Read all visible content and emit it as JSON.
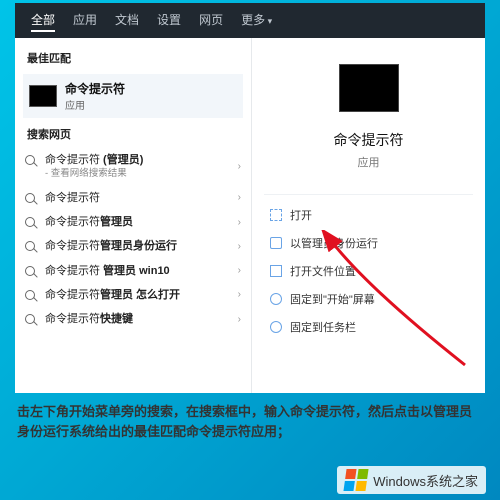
{
  "tabs": {
    "all": "全部",
    "apps": "应用",
    "docs": "文档",
    "settings": "设置",
    "web": "网页",
    "more": "更多"
  },
  "sections": {
    "best_match": "最佳匹配",
    "search_web": "搜索网页"
  },
  "best_match": {
    "title": "命令提示符",
    "subtitle": "应用"
  },
  "web_results": [
    {
      "base": "命令提示符",
      "suffix": " (管理员)",
      "note": "- 查看网络搜索结果"
    },
    {
      "base": "命令提示符",
      "suffix": "",
      "note": ""
    },
    {
      "base": "命令提示符",
      "suffix": "管理员",
      "note": ""
    },
    {
      "base": "命令提示符",
      "suffix": "管理员身份运行",
      "note": ""
    },
    {
      "base": "命令提示符",
      "suffix": " 管理员 win10",
      "note": ""
    },
    {
      "base": "命令提示符",
      "suffix": "管理员 怎么打开",
      "note": ""
    },
    {
      "base": "命令提示符",
      "suffix": "快捷键",
      "note": ""
    }
  ],
  "detail": {
    "title": "命令提示符",
    "subtitle": "应用",
    "actions": {
      "open": "打开",
      "run_admin": "以管理员身份运行",
      "open_location": "打开文件位置",
      "pin_start": "固定到\"开始\"屏幕",
      "pin_taskbar": "固定到任务栏"
    }
  },
  "caption": "击左下角开始菜单旁的搜索，在搜索框中，输入命令提示符，然后点击以管理员身份运行系统给出的最佳匹配命令提示符应用；",
  "footer": "Windows系统之家"
}
